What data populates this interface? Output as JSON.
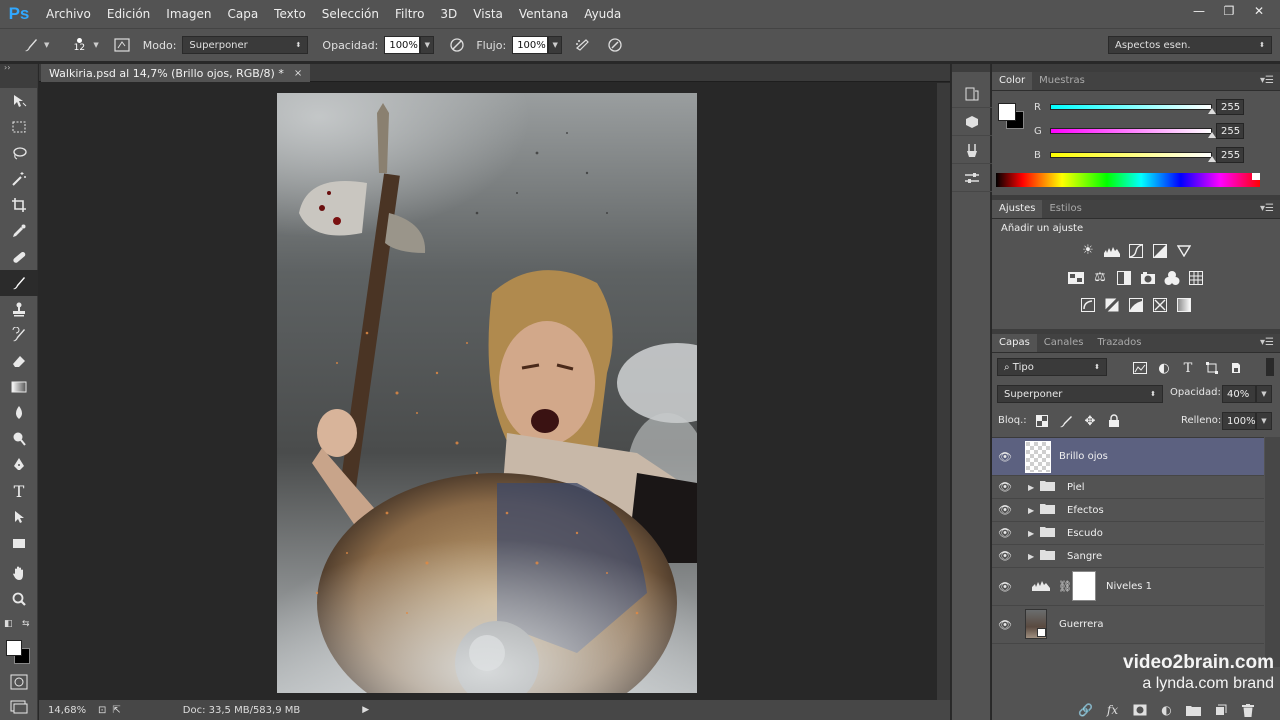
{
  "app": {
    "logo": "Ps",
    "menu": [
      "Archivo",
      "Edición",
      "Imagen",
      "Capa",
      "Texto",
      "Selección",
      "Filtro",
      "3D",
      "Vista",
      "Ventana",
      "Ayuda"
    ],
    "window_controls": {
      "minimize": "—",
      "restore": "❐",
      "close": "✕"
    }
  },
  "options": {
    "brush_size": "12",
    "mode_label": "Modo:",
    "mode_value": "Superponer",
    "opacity_label": "Opacidad:",
    "opacity_value": "100%",
    "flow_label": "Flujo:",
    "flow_value": "100%",
    "workspace": "Aspectos esen."
  },
  "document": {
    "tab_title": "Walkiria.psd al 14,7% (Brillo ojos, RGB/8) *",
    "close": "×",
    "zoom": "14,68%",
    "doc_info": "Doc: 33,5 MB/583,9 MB"
  },
  "color_panel": {
    "tabs": [
      "Color",
      "Muestras"
    ],
    "channels": [
      {
        "label": "R",
        "value": "255",
        "gradient_end": "#00ffff"
      },
      {
        "label": "G",
        "value": "255",
        "gradient_end": "#ff00ff"
      },
      {
        "label": "B",
        "value": "255",
        "gradient_end": "#ffff00"
      }
    ]
  },
  "adjustments_panel": {
    "tabs": [
      "Ajustes",
      "Estilos"
    ],
    "heading": "Añadir un ajuste"
  },
  "layers_panel": {
    "tabs": [
      "Capas",
      "Canales",
      "Trazados"
    ],
    "filter_kind": "Tipo",
    "blend_mode": "Superponer",
    "opacity_label": "Opacidad:",
    "opacity_value": "40%",
    "lock_label": "Bloq.:",
    "fill_label": "Relleno:",
    "fill_value": "100%",
    "layers": [
      {
        "name": "Brillo ojos",
        "kind": "pixel",
        "selected": true
      },
      {
        "name": "Piel",
        "kind": "group"
      },
      {
        "name": "Efectos",
        "kind": "group"
      },
      {
        "name": "Escudo",
        "kind": "group"
      },
      {
        "name": "Sangre",
        "kind": "group"
      },
      {
        "name": "Niveles 1",
        "kind": "adjustment"
      },
      {
        "name": "Guerrera",
        "kind": "smart"
      }
    ]
  },
  "watermark": {
    "line1": "video2brain.com",
    "line2": "a lynda.com brand"
  }
}
